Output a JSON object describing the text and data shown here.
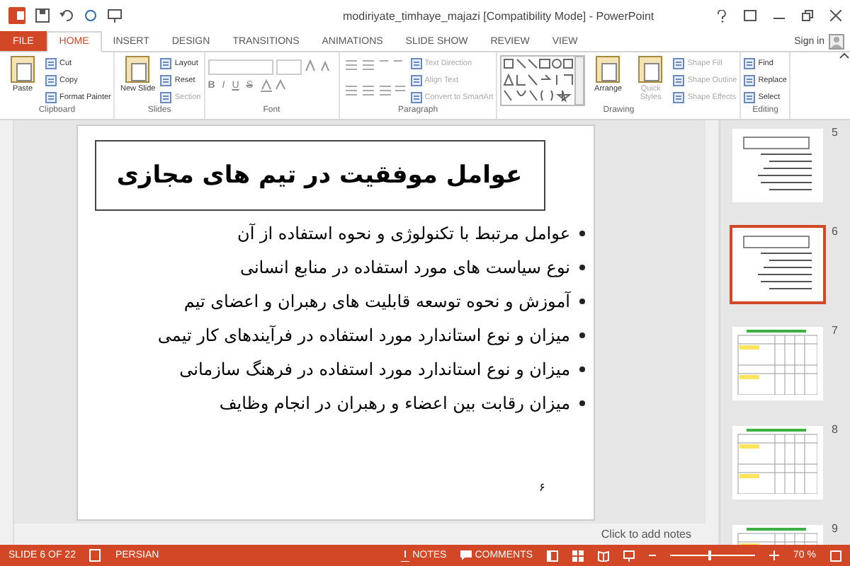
{
  "window": {
    "title": "modiriyate_timhaye_majazi [Compatibility Mode] - PowerPoint"
  },
  "tabs": [
    {
      "label": "FILE",
      "kind": "file",
      "selected": false
    },
    {
      "label": "HOME",
      "kind": "tab",
      "selected": true
    },
    {
      "label": "INSERT",
      "kind": "tab",
      "selected": false
    },
    {
      "label": "DESIGN",
      "kind": "tab",
      "selected": false
    },
    {
      "label": "TRANSITIONS",
      "kind": "tab",
      "selected": false
    },
    {
      "label": "ANIMATIONS",
      "kind": "tab",
      "selected": false
    },
    {
      "label": "SLIDE SHOW",
      "kind": "tab",
      "selected": false
    },
    {
      "label": "REVIEW",
      "kind": "tab",
      "selected": false
    },
    {
      "label": "VIEW",
      "kind": "tab",
      "selected": false
    }
  ],
  "account": {
    "label": "Sign in"
  },
  "ribbon": {
    "groups": [
      {
        "name": "Clipboard",
        "items": [
          {
            "kind": "large",
            "label": "Paste",
            "disabled": false
          },
          {
            "kind": "stack",
            "items": [
              {
                "label": "Cut",
                "disabled": false
              },
              {
                "label": "Copy",
                "disabled": false
              },
              {
                "label": "Format Painter",
                "disabled": false
              }
            ]
          }
        ]
      },
      {
        "name": "Slides",
        "items": [
          {
            "kind": "large",
            "label": "New Slide",
            "disabled": false
          },
          {
            "kind": "stack",
            "items": [
              {
                "label": "Layout",
                "disabled": false
              },
              {
                "label": "Reset",
                "disabled": false
              },
              {
                "label": "Section",
                "disabled": true
              }
            ]
          }
        ]
      },
      {
        "name": "Font",
        "items": [
          {
            "kind": "font",
            "letters": [
              "B",
              "I",
              "U",
              "S"
            ]
          }
        ]
      },
      {
        "name": "Paragraph",
        "items": [
          {
            "kind": "paragraph"
          },
          {
            "kind": "stack",
            "items": [
              {
                "label": "Text Direction",
                "disabled": true
              },
              {
                "label": "Align Text",
                "disabled": true
              },
              {
                "label": "Convert to SmartArt",
                "disabled": true
              }
            ]
          }
        ]
      },
      {
        "name": "Drawing",
        "items": [
          {
            "kind": "shapes"
          },
          {
            "kind": "large",
            "label": "Arrange",
            "disabled": false
          },
          {
            "kind": "large",
            "label": "Quick Styles",
            "disabled": true
          },
          {
            "kind": "stack",
            "items": [
              {
                "label": "Shape Fill",
                "disabled": true
              },
              {
                "label": "Shape Outline",
                "disabled": true
              },
              {
                "label": "Shape Effects",
                "disabled": true
              }
            ]
          }
        ]
      },
      {
        "name": "Editing",
        "items": [
          {
            "kind": "stack",
            "items": [
              {
                "label": "Find",
                "disabled": false
              },
              {
                "label": "Replace",
                "disabled": false
              },
              {
                "label": "Select",
                "disabled": false
              }
            ]
          }
        ]
      }
    ]
  },
  "slide": {
    "title": "عوامل موفقیت در تیم های مجازی",
    "bullets": [
      "عوامل مرتبط با تکنولوژی و نحوه استفاده از آن",
      "نوع سیاست های مورد استفاده در منابع انسانی",
      "آموزش و نحوه توسعه قابلیت های رهبران و اعضای تیم",
      "میزان و نوع استاندارد مورد استفاده در فرآیندهای کار تیمی",
      "میزان و نوع استاندارد مورد استفاده در فرهنگ سازمانی",
      "میزان رقابت بین اعضاء و رهبران در انجام وظایف"
    ],
    "number": "۶"
  },
  "notes": {
    "placeholder": "Click to add notes"
  },
  "thumbnails": [
    {
      "number": "5",
      "kind": "text",
      "selected": false
    },
    {
      "number": "6",
      "kind": "text",
      "selected": true
    },
    {
      "number": "7",
      "kind": "table",
      "selected": false
    },
    {
      "number": "8",
      "kind": "table",
      "selected": false
    },
    {
      "number": "9",
      "kind": "table",
      "selected": false
    }
  ],
  "status_bar": {
    "slide": "SLIDE 6 OF 22",
    "language": "PERSIAN",
    "notes": "NOTES",
    "comments": "COMMENTS",
    "zoom": {
      "level": 0.45,
      "reading": "70 %"
    }
  }
}
